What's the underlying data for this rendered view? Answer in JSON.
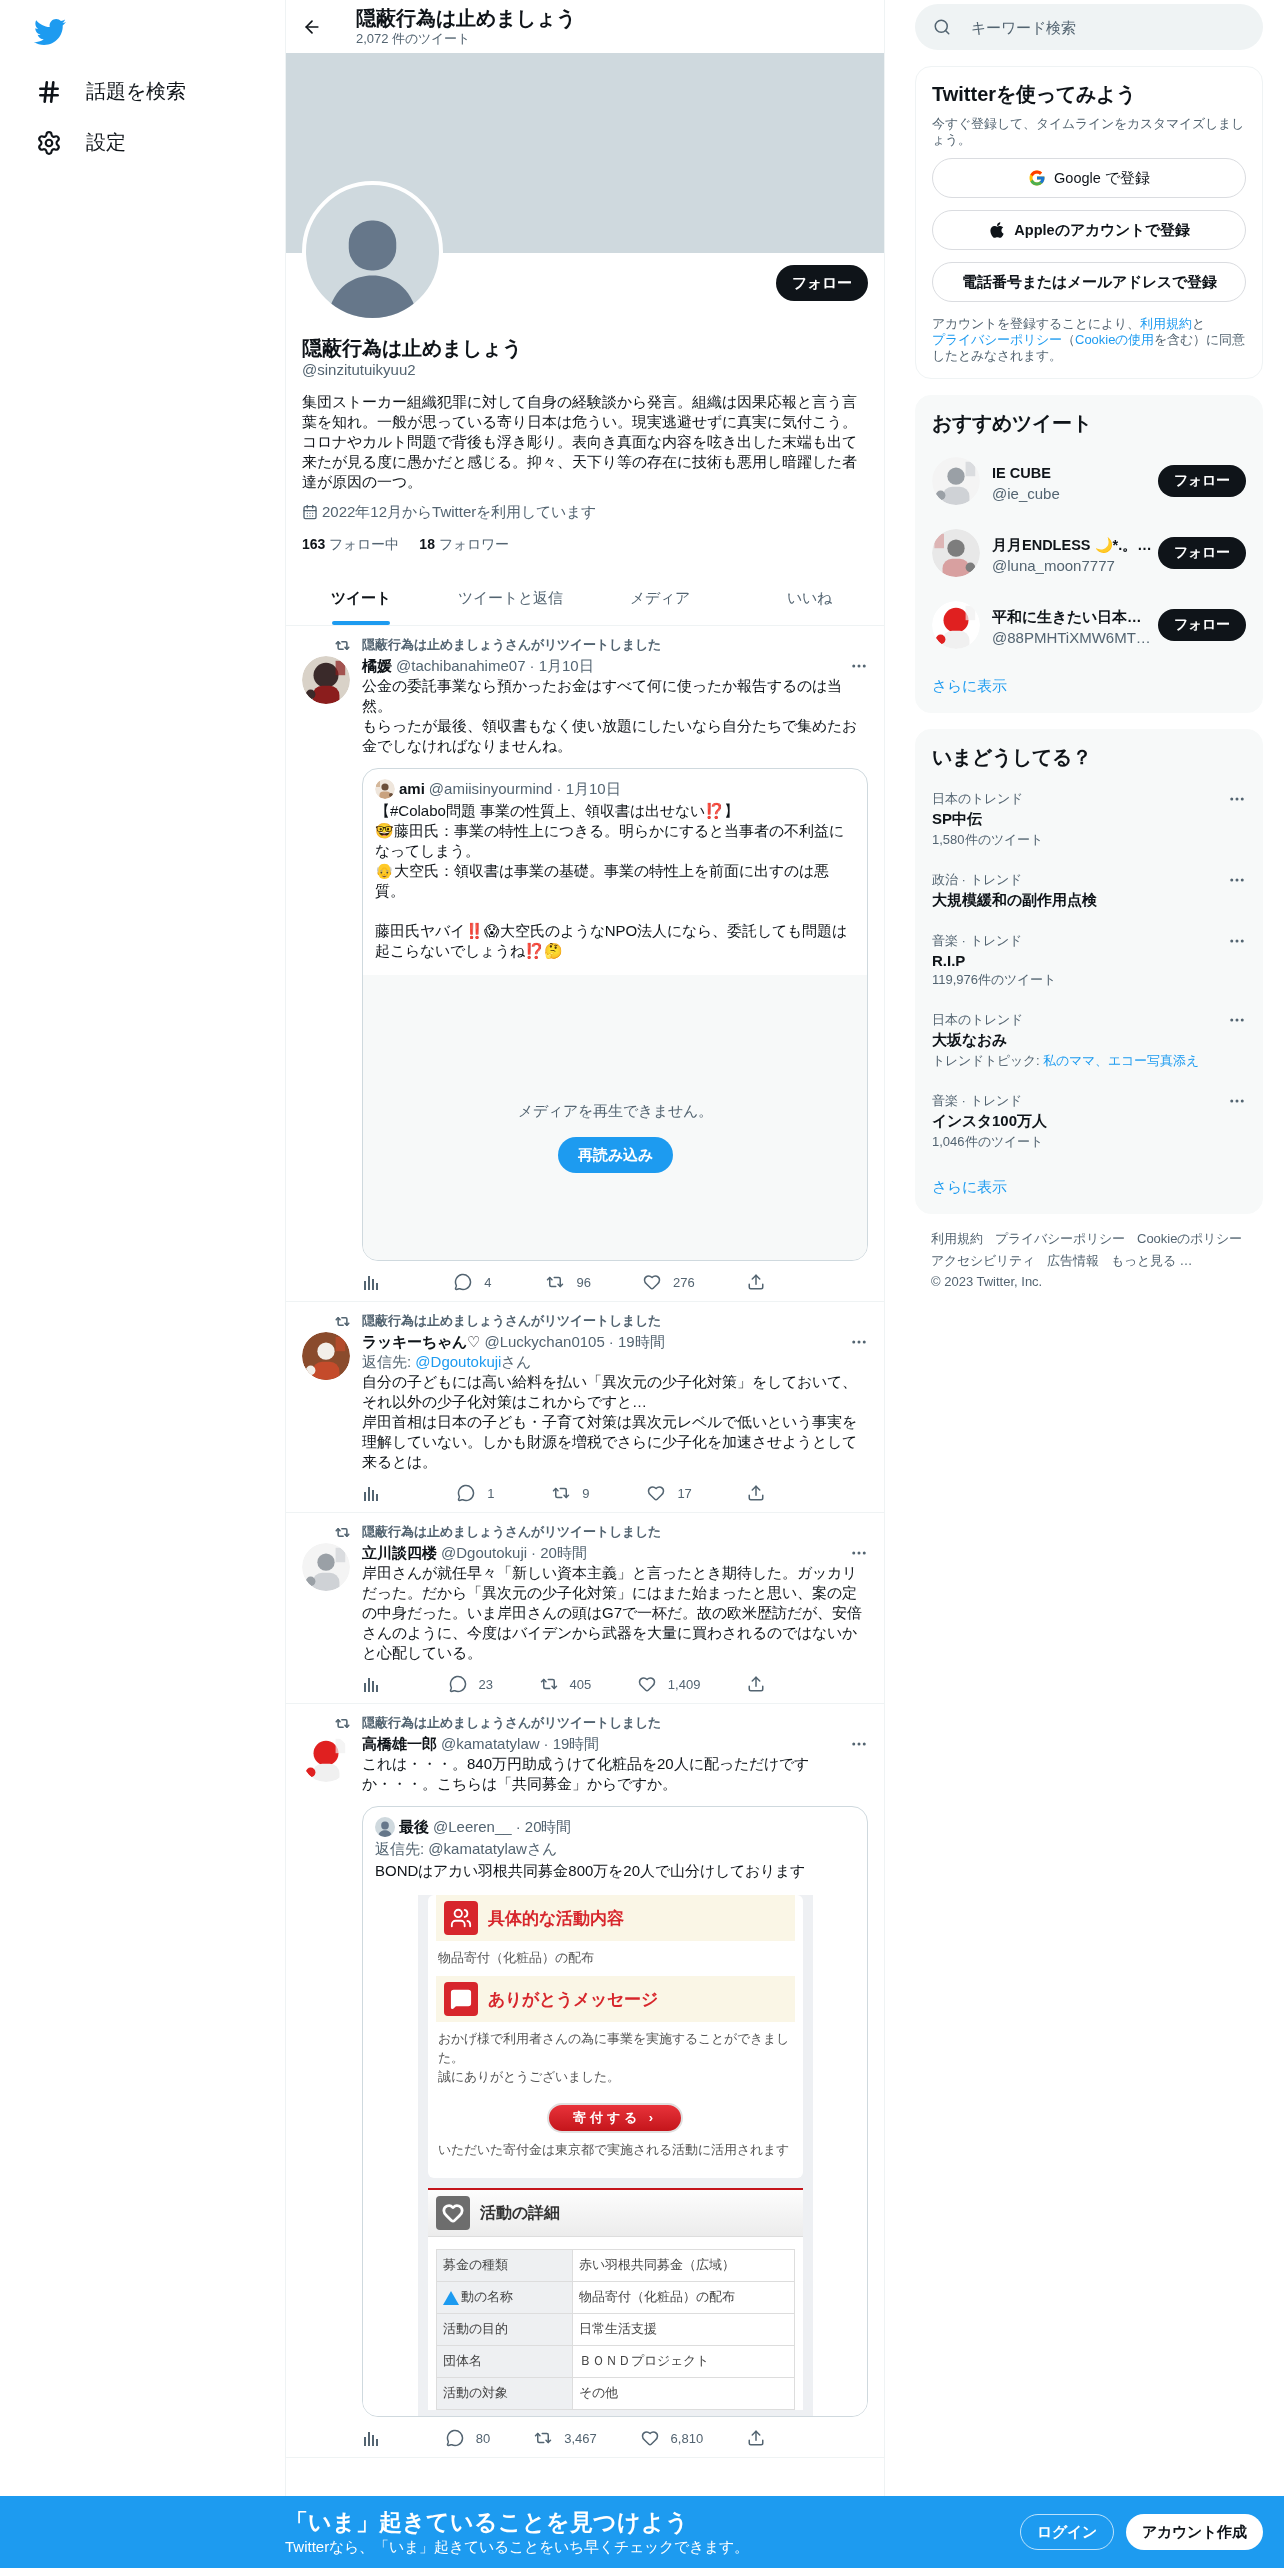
{
  "sidebar": {
    "nav": [
      {
        "kind": "hashtag",
        "label": "話題を検索"
      },
      {
        "kind": "gear",
        "label": "設定"
      }
    ]
  },
  "header": {
    "title": "隠蔽行為は止めましょう",
    "subtitle": "2,072 件のツイート"
  },
  "profile": {
    "follow_button": "フォロー",
    "name": "隠蔽行為は止めましょう",
    "handle": "@sinzitutuikyuu2",
    "bio": "集団ストーカー組織犯罪に対して自身の経験談から発言。組織は因果応報と言う言葉を知れ。一般が思っている寄り日本は危うい。現実逃避せずに真実に気付こう。コロナやカルト問題で背後も浮き彫り。表向き真面な内容を呟き出した末端も出て来たが見る度に愚かだと感じる。抑々、天下り等の存在に技術も悪用し暗躍した者達が原因の一つ。",
    "joined": "2022年12月からTwitterを利用しています",
    "stats": [
      {
        "count": "163",
        "label": "フォロー中"
      },
      {
        "count": "18",
        "label": "フォロワー"
      }
    ]
  },
  "tabs": [
    {
      "label": "ツイート",
      "selected": true
    },
    {
      "label": "ツイートと返信",
      "selected": false
    },
    {
      "label": "メディア",
      "selected": false
    },
    {
      "label": "いいね",
      "selected": false
    }
  ],
  "tweets": [
    {
      "retweeted_by": "隠蔽行為は止めましょうさんがリツイートしました",
      "author": "橘媛",
      "handle": "@tachibanahime07",
      "time": "· 1月10日",
      "paragraphs": [
        [
          "公金の委託事業なら預かったお金はすべて何に使ったか報告するのは当然。",
          "もらったが最後、領収書もなく使い放題にしたいなら自分たちで集めたお金でしなければなりませんね。"
        ]
      ],
      "quote": {
        "avatar": {
          "kind": "picture"
        },
        "author": "ami",
        "handle": "@amiisinyourmind",
        "time": "· 1月10日",
        "paragraphs": [
          [
            "【#Colabo問題 事業の性質上、領収書は出せない⁉️】",
            "🤓藤田氏：事業の特性上につきる。明らかにすると当事者の不利益になってしまう。",
            "👴大空氏：領収書は事業の基礎。事業の特性上を前面に出すのは悪質。"
          ],
          [
            "藤田氏ヤバイ‼️😱大空氏のようなNPO法人になら、委託しても問題は起こらないでしょうね⁉️🤔"
          ]
        ],
        "media": {
          "kind": "unavailable",
          "message": "メディアを再生できません。",
          "button": "再読み込み"
        }
      },
      "replies": "4",
      "retweets": "96",
      "likes": "276"
    },
    {
      "retweeted_by": "隠蔽行為は止めましょうさんがリツイートしました",
      "author": "ラッキーちゃん♡",
      "handle": "@Luckychan0105",
      "time": "· 19時間",
      "reply_to": {
        "prefix": "返信先: ",
        "link": "@Dgoutokuji",
        "suffix": "さん"
      },
      "paragraphs": [
        [
          "自分の子どもには高い給料を払い「異次元の少子化対策」をしておいて、それ以外の少子化対策はこれからですと…",
          "岸田首相は日本の子ども・子育て対策は異次元レベルで低いという事実を理解していない。しかも財源を増税でさらに少子化を加速させようとして来るとは。"
        ]
      ],
      "replies": "1",
      "retweets": "9",
      "likes": "17"
    },
    {
      "retweeted_by": "隠蔽行為は止めましょうさんがリツイートしました",
      "author": "立川談四楼",
      "handle": "@Dgoutokuji",
      "time": "· 20時間",
      "paragraphs": [
        [
          "岸田さんが就任早々「新しい資本主義」と言ったとき期待した。ガッカリだった。だから「異次元の少子化対策」にはまた始まったと思い、案の定の中身だった。いま岸田さんの頭はG7で一杯だ。故の欧米歴訪だが、安倍さんのように、今度はバイデンから武器を大量に買わされるのではないかと心配している。"
        ]
      ],
      "replies": "23",
      "retweets": "405",
      "likes": "1,409"
    },
    {
      "retweeted_by": "隠蔽行為は止めましょうさんがリツイートしました",
      "author": "高橋雄一郎",
      "handle": "@kamatatylaw",
      "time": "· 19時間",
      "paragraphs": [
        [
          "これは・・・。840万円助成うけて化粧品を20人に配っただけですか・・・。こちらは「共同募金」からですか。"
        ]
      ],
      "quote": {
        "avatar": {
          "kind": "default"
        },
        "author": "最後",
        "handle": "@Leeren__",
        "time": "· 20時間",
        "reply_line": "返信先: @kamatatylawさん",
        "paragraphs": [
          [
            "BONDはアカい羽根共同募金800万を20人で山分けしております"
          ]
        ],
        "media": {
          "kind": "screenshot",
          "heading_1": "具体的な活動内容",
          "text_1": "物品寄付（化粧品）の配布",
          "heading_2": "ありがとうメッセージ",
          "message_lines": [
            "おかげ様で利用者さんの為に事業を実施することができました。",
            "誠にありがとうございました。"
          ],
          "donate_button": "寄付する ›",
          "note": "いただいた寄付金は東京都で実施される活動に活用されます",
          "details_title": "活動の詳細",
          "rows": [
            {
              "label": "募金の種類",
              "value": "赤い羽根共同募金（広域）",
              "overlay": false
            },
            {
              "label": "動の名称",
              "value": "物品寄付（化粧品）の配布",
              "overlay": true
            },
            {
              "label": "活動の目的",
              "value": "日常生活支援",
              "overlay": false
            },
            {
              "label": "団体名",
              "value": "ＢＯＮＤプロジェクト",
              "overlay": false
            },
            {
              "label": "活動の対象",
              "value": "その他",
              "overlay": false
            }
          ]
        }
      },
      "replies": "80",
      "retweets": "3,467",
      "likes": "6,810"
    }
  ],
  "right": {
    "search": {
      "placeholder": "キーワード検索"
    },
    "signup": {
      "title": "Twitterを使ってみよう",
      "subtitle": "今すぐ登録して、タイムラインをカスタマイズしましょう。",
      "buttons": [
        {
          "kind": "google",
          "label": "Google で登録"
        },
        {
          "kind": "apple",
          "label": "Appleのアカウントで登録"
        },
        {
          "kind": "plain",
          "label": "電話番号またはメールアドレスで登録"
        }
      ],
      "legal": [
        {
          "text": "アカウントを登録することにより、",
          "link": false
        },
        {
          "text": "利用規約",
          "link": true
        },
        {
          "text": "と",
          "link": false
        },
        {
          "text": "プライバシーポリシー",
          "link": true
        },
        {
          "text": "（",
          "link": false
        },
        {
          "text": "Cookieの使用",
          "link": true
        },
        {
          "text": "を含む）に同意したとみなされます。",
          "link": false
        }
      ]
    },
    "recommended": {
      "title": "おすすめツイート",
      "users": [
        {
          "name": "IE CUBE",
          "handle": "@ie_cube",
          "button": "フォロー"
        },
        {
          "name": "月月ENDLESS 🌙*.。…",
          "handle": "@luna_moon7777",
          "button": "フォロー"
        },
        {
          "name": "平和に生きたい日本…",
          "handle": "@88PMHTiXMW6MT…",
          "button": "フォロー"
        }
      ],
      "more": "さらに表示"
    },
    "trends": {
      "title": "いまどうしてる？",
      "items": [
        {
          "context": "日本のトレンド",
          "name": "SP中伝",
          "meta": "1,580件のツイート"
        },
        {
          "context": "政治 · トレンド",
          "name": "大規模緩和の副作用点検"
        },
        {
          "context": "音楽 · トレンド",
          "name": "R.I.P",
          "meta": "119,976件のツイート"
        },
        {
          "context": "日本のトレンド",
          "name": "大坂なおみ",
          "topic_prefix": "トレンドトピック: ",
          "topics": "私のママ、エコー写真添え"
        },
        {
          "context": "音楽 · トレンド",
          "name": "インスタ100万人",
          "meta": "1,046件のツイート"
        }
      ],
      "more": "さらに表示"
    },
    "footer": [
      "利用規約",
      "プライバシーポリシー",
      "Cookieのポリシー",
      "アクセシビリティ",
      "広告情報",
      "もっと見る …",
      "© 2023 Twitter, Inc."
    ]
  },
  "bottom_bar": {
    "title": "「いま」起きていることを見つけよう",
    "subtitle": "Twitterなら、「いま」起きていることをいち早くチェックできます。",
    "login": "ログイン",
    "signup": "アカウント作成"
  }
}
